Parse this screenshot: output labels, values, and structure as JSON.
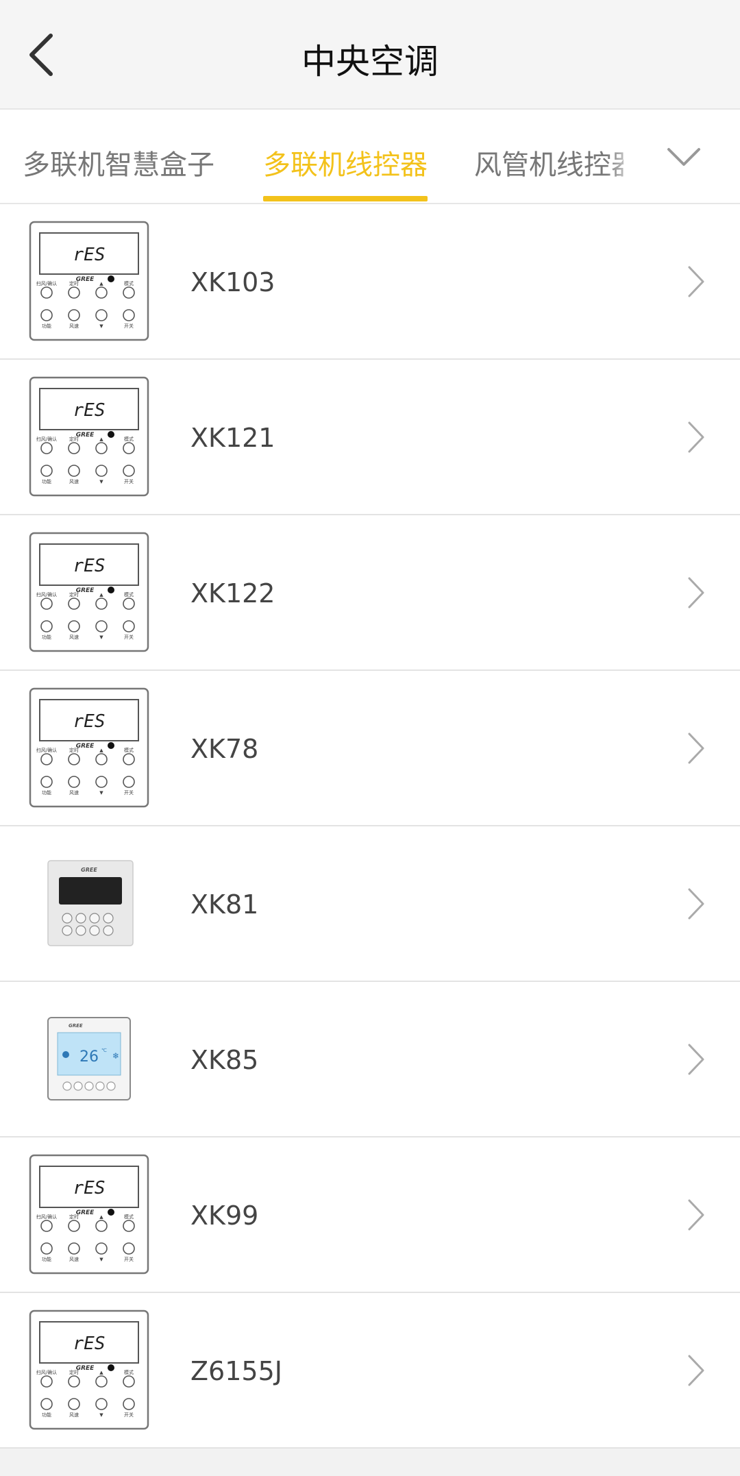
{
  "header": {
    "title": "中央空调",
    "back_icon": "chevron-left-icon"
  },
  "tabs": [
    {
      "label": "多联机智慧盒子",
      "active": false
    },
    {
      "label": "多联机线控器",
      "active": true
    },
    {
      "label": "风管机线控器",
      "active": false
    }
  ],
  "tabs_more_icon": "chevron-down-icon",
  "accent_color": "#f3c21b",
  "items": [
    {
      "name": "XK103",
      "image": "wired-controller-lcd"
    },
    {
      "name": "XK121",
      "image": "wired-controller-lcd"
    },
    {
      "name": "XK122",
      "image": "wired-controller-lcd"
    },
    {
      "name": "XK78",
      "image": "wired-controller-lcd"
    },
    {
      "name": "XK81",
      "image": "wired-controller-black-screen"
    },
    {
      "name": "XK85",
      "image": "wired-controller-blue-screen"
    },
    {
      "name": "XK99",
      "image": "wired-controller-lcd"
    },
    {
      "name": "Z6155J",
      "image": "wired-controller-lcd"
    }
  ],
  "thumb_text": {
    "screen": "rES",
    "brand": "GREE",
    "btn_labels": [
      "扫风/确认",
      "定时",
      "▲",
      "模式",
      "功能",
      "风速",
      "▼",
      "开关"
    ],
    "xk85_temp": "26",
    "xk85_unit": "℃"
  }
}
